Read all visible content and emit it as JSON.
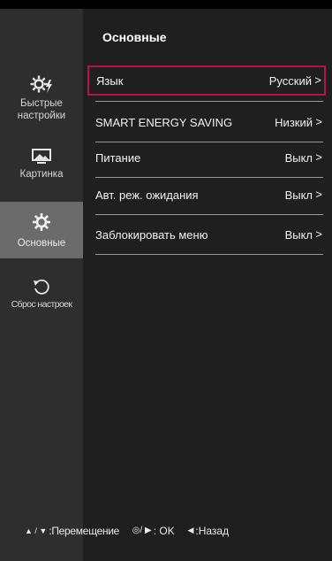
{
  "sidebar": {
    "items": [
      {
        "label": "Быстрые\nнастройки",
        "icon": "quick-settings-icon"
      },
      {
        "label": "Картинка",
        "icon": "picture-icon"
      },
      {
        "label": "Основные",
        "icon": "gear-icon",
        "active": true
      },
      {
        "label": "Сброс настроек",
        "icon": "reset-icon"
      }
    ]
  },
  "main": {
    "title": "Основные",
    "rows": [
      {
        "label": "Язык",
        "value": "Русский"
      },
      {
        "label": "SMART ENERGY SAVING",
        "value": "Низкий"
      },
      {
        "label": "Питание",
        "value": "Выкл"
      },
      {
        "label": "Авт. реж. ожидания",
        "value": "Выкл"
      },
      {
        "label": "Заблокировать меню",
        "value": "Выкл"
      }
    ]
  },
  "footer": {
    "move_glyph": "▲ / ▼",
    "move_label": ":Перемещение",
    "ok_glyph": "◎/ ▶",
    "ok_label": ": OK",
    "back_glyph": "◀",
    "back_label": ":Назад"
  },
  "colors": {
    "selection": "#b5134f",
    "active_sidebar": "#6b6b6b"
  }
}
